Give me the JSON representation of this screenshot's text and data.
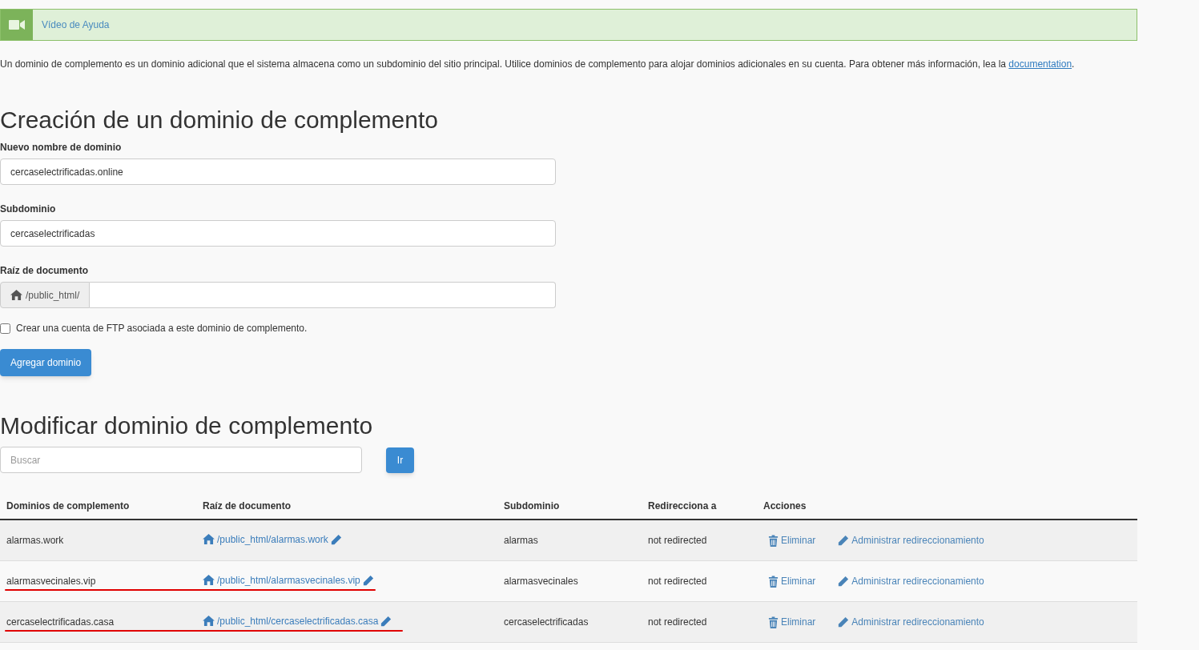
{
  "help_banner": {
    "label": "Vídeo de Ayuda"
  },
  "intro": {
    "text": "Un dominio de complemento es un dominio adicional que el sistema almacena como un subdominio del sitio principal. Utilice dominios de complemento para alojar dominios adicionales en su cuenta. Para obtener más información, lea la",
    "link": "documentation",
    "after": "."
  },
  "create": {
    "title": "Creación de un dominio de complemento",
    "fields": [
      {
        "label": "Nuevo nombre de dominio",
        "value": "cercaselectrificadas.online"
      },
      {
        "label": "Subdominio",
        "value": "cercaselectrificadas"
      }
    ],
    "docroot": {
      "label": "Raíz de documento",
      "prefix": "/public_html/"
    },
    "ftp_checkbox": {
      "label": "Crear una cuenta de FTP asociada a este dominio de complemento.",
      "checked": false
    },
    "submit": "Agregar dominio"
  },
  "modify": {
    "title": "Modificar dominio de complemento",
    "search": {
      "placeholder": "Buscar"
    },
    "go": "Ir",
    "table": {
      "columns": [
        "Dominios de complemento",
        "Raíz de documento",
        "Subdominio",
        "Redirecciona a",
        "Acciones"
      ],
      "rows": [
        {
          "domain": "alarmas.work",
          "docroot": "/public_html/alarmas.work",
          "subdomain": "alarmas",
          "redirect": "not redirected",
          "delete": "Eliminar",
          "manage": "Administrar redireccionamiento",
          "underlined": false
        },
        {
          "domain": "alarmasvecinales.vip",
          "docroot": "/public_html/alarmasvecinales.vip",
          "subdomain": "alarmasvecinales",
          "redirect": "not redirected",
          "delete": "Eliminar",
          "manage": "Administrar redireccionamiento",
          "underlined": true
        },
        {
          "domain": "cercaselectrificadas.casa",
          "docroot": "/public_html/cercaselectrificadas.casa",
          "subdomain": "cercaselectrificadas",
          "redirect": "not redirected",
          "delete": "Eliminar",
          "manage": "Administrar redireccionamiento",
          "underlined": true
        }
      ]
    }
  }
}
